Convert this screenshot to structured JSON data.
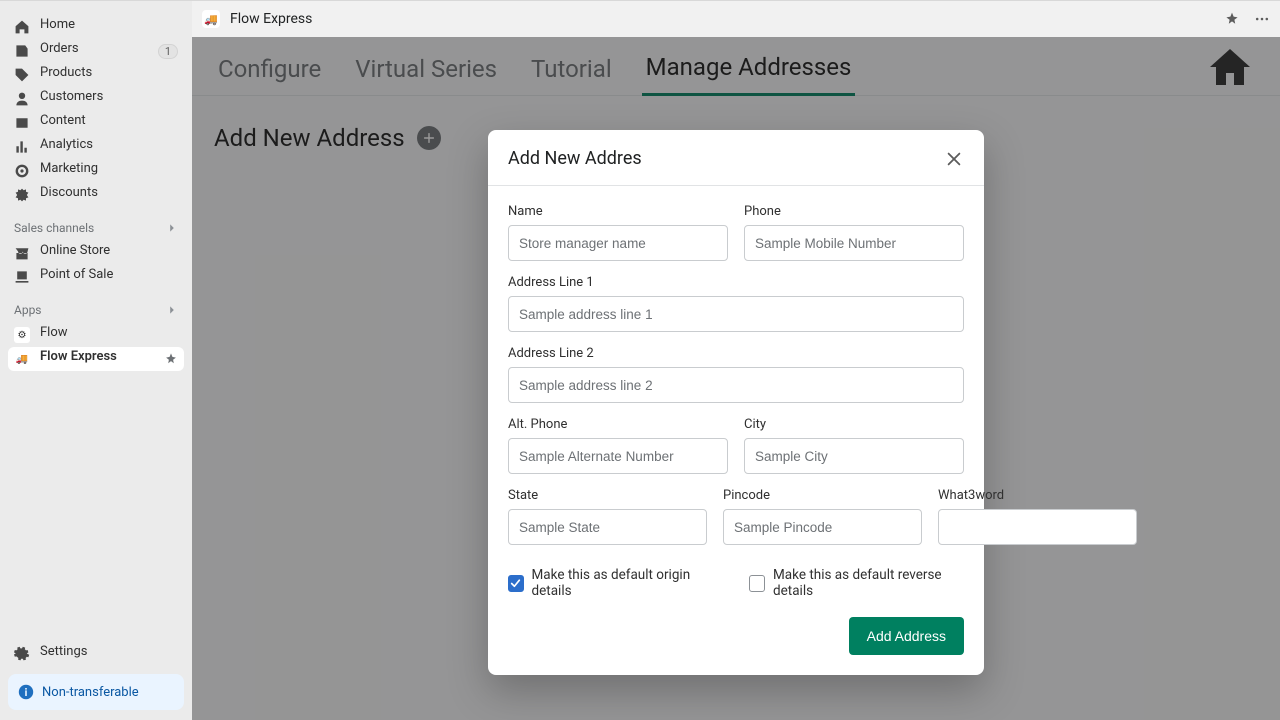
{
  "sidebar": {
    "items": [
      {
        "label": "Home"
      },
      {
        "label": "Orders",
        "badge": "1"
      },
      {
        "label": "Products"
      },
      {
        "label": "Customers"
      },
      {
        "label": "Content"
      },
      {
        "label": "Analytics"
      },
      {
        "label": "Marketing"
      },
      {
        "label": "Discounts"
      }
    ],
    "sales_channels_header": "Sales channels",
    "sales_channels": [
      {
        "label": "Online Store"
      },
      {
        "label": "Point of Sale"
      }
    ],
    "apps_header": "Apps",
    "apps": [
      {
        "label": "Flow"
      },
      {
        "label": "Flow Express"
      }
    ],
    "settings_label": "Settings",
    "banner_label": "Non-transferable"
  },
  "topbar": {
    "app_title": "Flow Express"
  },
  "tabs": [
    {
      "label": "Configure"
    },
    {
      "label": "Virtual Series"
    },
    {
      "label": "Tutorial"
    },
    {
      "label": "Manage Addresses"
    }
  ],
  "page": {
    "title": "Add New Address"
  },
  "modal": {
    "title": "Add New Addres",
    "name_label": "Name",
    "name_placeholder": "Store manager name",
    "phone_label": "Phone",
    "phone_placeholder": "Sample Mobile Number",
    "addr1_label": "Address Line 1",
    "addr1_placeholder": "Sample address line 1",
    "addr2_label": "Address Line 2",
    "addr2_placeholder": "Sample address line 2",
    "altphone_label": "Alt. Phone",
    "altphone_placeholder": "Sample Alternate Number",
    "city_label": "City",
    "city_placeholder": "Sample City",
    "state_label": "State",
    "state_placeholder": "Sample State",
    "pincode_label": "Pincode",
    "pincode_placeholder": "Sample Pincode",
    "w3w_label": "What3word",
    "w3w_placeholder": "",
    "check_origin": "Make this as default origin details",
    "check_reverse": "Make this as default reverse details",
    "submit_label": "Add Address"
  }
}
